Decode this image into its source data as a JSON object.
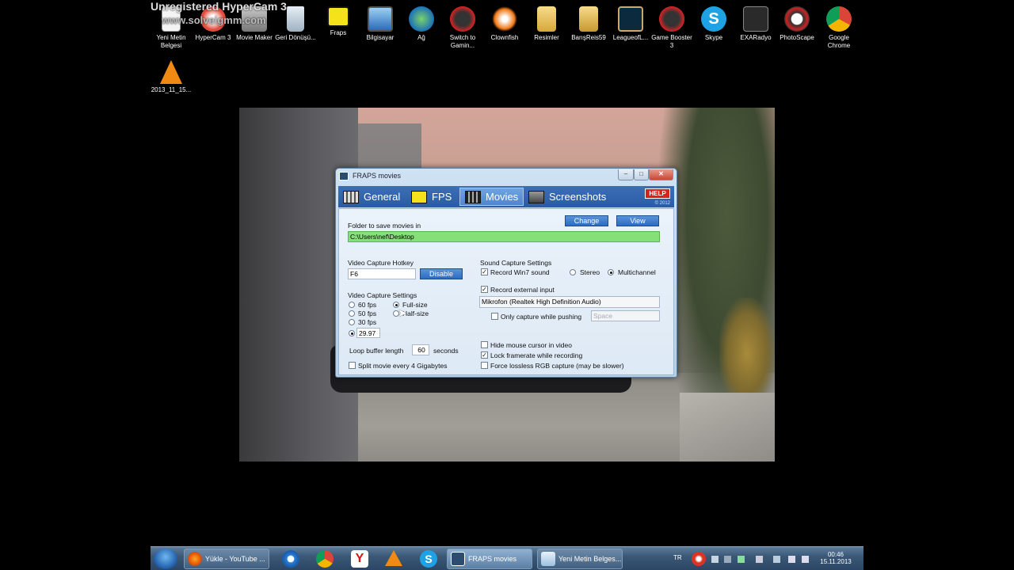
{
  "watermark": {
    "line1": "Unregistered HyperCam 3",
    "line2": "www.solveigmm.com"
  },
  "desktop": {
    "icons": [
      {
        "label": "Yeni Metin Belgesi",
        "icon": "text-document-icon"
      },
      {
        "label": "HyperCam 3",
        "icon": "hypercam-icon"
      },
      {
        "label": "Movie Maker",
        "icon": "movie-maker-icon"
      },
      {
        "label": "Geri Dönüşü...",
        "icon": "recycle-bin-icon"
      },
      {
        "label": "Fraps",
        "icon": "fraps-icon"
      },
      {
        "label": "Bilgisayar",
        "icon": "computer-icon"
      },
      {
        "label": "Ağ",
        "icon": "network-icon"
      },
      {
        "label": "Switch to Gamin...",
        "icon": "game-booster-icon"
      },
      {
        "label": "Clownfish",
        "icon": "clownfish-icon"
      },
      {
        "label": "Resimler",
        "icon": "folder-icon"
      },
      {
        "label": "BarışReis59",
        "icon": "user-folder-icon"
      },
      {
        "label": "LeagueofL...",
        "icon": "league-of-legends-icon"
      },
      {
        "label": "Game Booster 3",
        "icon": "game-booster-icon"
      },
      {
        "label": "Skype",
        "icon": "skype-icon"
      },
      {
        "label": "EXARadyo",
        "icon": "radio-icon"
      },
      {
        "label": "PhotoScape",
        "icon": "photoscape-icon"
      },
      {
        "label": "Google Chrome",
        "icon": "chrome-icon"
      },
      {
        "label": "2013_11_15...",
        "icon": "vlc-icon"
      }
    ]
  },
  "fraps": {
    "title": "FRAPS movies",
    "tabs": {
      "general": "General",
      "fps": "FPS",
      "movies": "Movies",
      "screenshots": "Screenshots"
    },
    "help": "HELP",
    "copyright": "© 2012",
    "folder_label": "Folder to save movies in",
    "folder_path": "C:\\Users\\nef\\Desktop",
    "change_label": "Change",
    "view_label": "View",
    "hotkey_label": "Video Capture Hotkey",
    "hotkey_value": "F6",
    "disable_label": "Disable",
    "capture_settings_label": "Video Capture Settings",
    "fps_options": [
      "60 fps",
      "50 fps",
      "30 fps"
    ],
    "custom_fps": "29.97",
    "size_options": [
      "Full-size",
      "Half-size"
    ],
    "loop_label": "Loop buffer length",
    "loop_value": "60",
    "loop_unit": "seconds",
    "split_label": "Split movie every 4 Gigabytes",
    "sound_label": "Sound Capture Settings",
    "record_win7": "Record Win7 sound",
    "stereo": "Stereo",
    "multichannel": "Multichannel",
    "record_external": "Record external input",
    "mic_device": "Mikrofon (Realtek High Definition Audio)",
    "only_capture": "Only capture while pushing",
    "push_key": "Space",
    "hide_mouse": "Hide mouse cursor in video",
    "lock_framerate": "Lock framerate while recording",
    "force_lossless": "Force lossless RGB capture (may be slower)",
    "state": {
      "selected_fps": "29.97",
      "selected_size": "Full-size",
      "selected_channels": "Multichannel",
      "record_win7": true,
      "record_external": true,
      "only_capture": false,
      "hide_mouse": false,
      "lock_framerate": true,
      "force_lossless": false,
      "split_movie": false
    }
  },
  "taskbar": {
    "buttons": [
      {
        "label": "Yükle - YouTube ...",
        "icon": "firefox-icon"
      },
      {
        "label": "FRAPS movies",
        "icon": "fraps-icon"
      },
      {
        "label": "Yeni Metin Belges...",
        "icon": "notepad-icon"
      }
    ],
    "pinned": [
      "internet-explorer-icon",
      "chrome-icon",
      "yandex-icon",
      "vlc-icon",
      "skype-icon"
    ],
    "language": "TR",
    "time": "00:46",
    "date": "15.11.2013"
  }
}
